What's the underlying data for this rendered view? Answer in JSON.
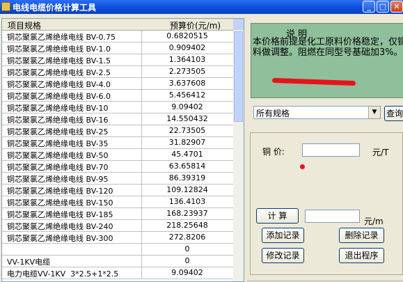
{
  "window": {
    "title": "电线电缆价格计算工具"
  },
  "table": {
    "headers": [
      "项目规格",
      "预算价(元/m)"
    ],
    "rows": [
      {
        "name": "铜芯聚氯乙烯绝缘电线 BV-0.75",
        "price": "0.6820515"
      },
      {
        "name": "铜芯聚氯乙烯绝缘电线 BV-1.0",
        "price": "0.909402"
      },
      {
        "name": "铜芯聚氯乙烯绝缘电线 BV-1.5",
        "price": "1.364103"
      },
      {
        "name": "铜芯聚氯乙烯绝缘电线 BV-2.5",
        "price": "2.273505"
      },
      {
        "name": "铜芯聚氯乙烯绝缘电线 BV-4.0",
        "price": "3.637608"
      },
      {
        "name": "铜芯聚氯乙烯绝缘电线 BV-6.0",
        "price": "5.456412"
      },
      {
        "name": "铜芯聚氯乙烯绝缘电线 BV-10",
        "price": "9.09402"
      },
      {
        "name": "铜芯聚氯乙烯绝缘电线 BV-16",
        "price": "14.550432"
      },
      {
        "name": "铜芯聚氯乙烯绝缘电线 BV-25",
        "price": "22.73505"
      },
      {
        "name": "铜芯聚氯乙烯绝缘电线 BV-35",
        "price": "31.82907"
      },
      {
        "name": "铜芯聚氯乙烯绝缘电线 BV-50",
        "price": "45.4701"
      },
      {
        "name": "铜芯聚氯乙烯绝缘电线 BV-70",
        "price": "63.65814"
      },
      {
        "name": "铜芯聚氯乙烯绝缘电线 BV-95",
        "price": "86.39319"
      },
      {
        "name": "铜芯聚氯乙烯绝缘电线 BV-120",
        "price": "109.12824"
      },
      {
        "name": "铜芯聚氯乙烯绝缘电线 BV-150",
        "price": "136.4103"
      },
      {
        "name": "铜芯聚氯乙烯绝缘电线 BV-185",
        "price": "168.23937"
      },
      {
        "name": "铜芯聚氯乙烯绝缘电线 BV-240",
        "price": "218.25648"
      },
      {
        "name": "铜芯聚氯乙烯绝缘电线 BV-300",
        "price": "272.8206"
      },
      {
        "name": "",
        "price": "0"
      },
      {
        "name": "VV-1KV电缆",
        "price": "0"
      },
      {
        "name": "电力电缆VV-1KV  3*2.5+1*2.5",
        "price": "9.09402"
      }
    ]
  },
  "note": {
    "heading": "说    明",
    "body": "本价格前提是化工原料价格稳定，仅铜材料做调整。阻燃在同型号基础加3%。"
  },
  "filter": {
    "selected": "所有规格",
    "query_label": "查询"
  },
  "form": {
    "copper_label": "铜  价:",
    "copper_value": "",
    "copper_unit": "元/T",
    "calc_label": "计 算",
    "result_value": "",
    "result_unit": "元/m"
  },
  "actions": {
    "add": "添加记录",
    "delete": "删除记录",
    "edit": "修改记录",
    "exit": "退出程序"
  },
  "colors": {
    "note_bg": "#8fbf9b",
    "titlebar": "#0a4cd9",
    "marker": "#e8131a"
  }
}
